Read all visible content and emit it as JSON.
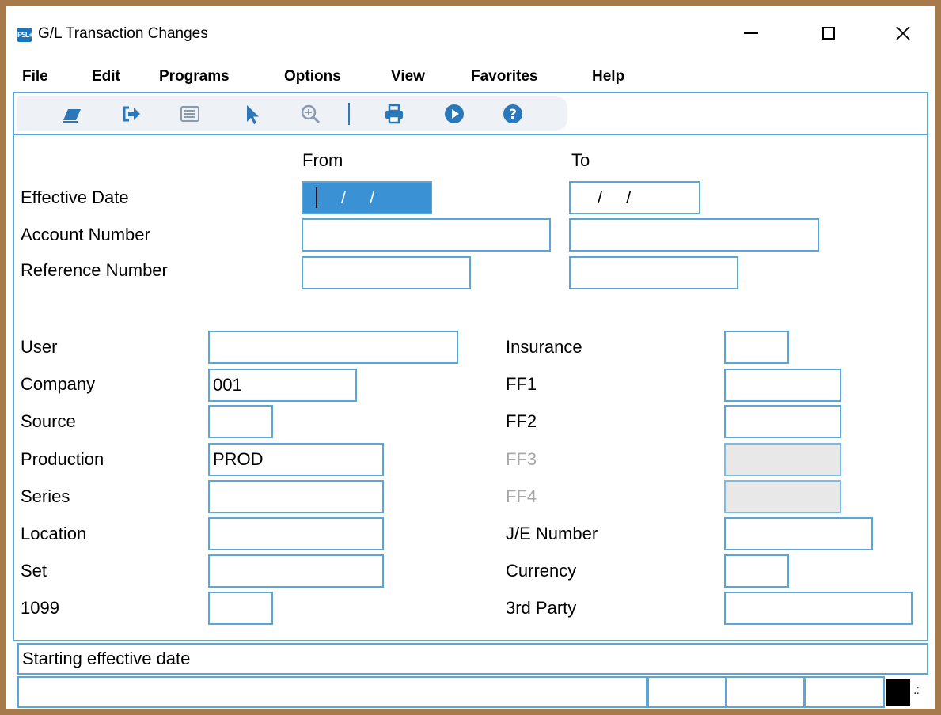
{
  "window": {
    "title": "G/L Transaction Changes",
    "app_icon_text": "PSL+"
  },
  "menu": [
    "File",
    "Edit",
    "Programs",
    "Options",
    "View",
    "Favorites",
    "Help"
  ],
  "toolbar": [
    {
      "icon": "eraser-icon"
    },
    {
      "icon": "exit-icon"
    },
    {
      "icon": "list-icon"
    },
    {
      "icon": "pointer-icon"
    },
    {
      "icon": "zoom-icon"
    },
    {
      "icon": "print-icon"
    },
    {
      "icon": "run-icon"
    },
    {
      "icon": "help-icon"
    }
  ],
  "range": {
    "from_header": "From",
    "to_header": "To",
    "effective_date_label": "Effective Date",
    "effective_date_from": "/ /",
    "effective_date_to": "/ /",
    "account_number_label": "Account Number",
    "reference_number_label": "Reference Number"
  },
  "left_fields": {
    "user": {
      "label": "User",
      "value": ""
    },
    "company": {
      "label": "Company",
      "value": "001"
    },
    "source": {
      "label": "Source",
      "value": ""
    },
    "production": {
      "label": "Production",
      "value": "PROD"
    },
    "series": {
      "label": "Series",
      "value": ""
    },
    "location": {
      "label": "Location",
      "value": ""
    },
    "set": {
      "label": "Set",
      "value": ""
    },
    "form1099": {
      "label": "1099",
      "value": ""
    }
  },
  "right_fields": {
    "insurance": {
      "label": "Insurance",
      "value": ""
    },
    "ff1": {
      "label": "FF1",
      "value": ""
    },
    "ff2": {
      "label": "FF2",
      "value": ""
    },
    "ff3": {
      "label": "FF3",
      "value": ""
    },
    "ff4": {
      "label": "FF4",
      "value": ""
    },
    "je_number": {
      "label": "J/E Number",
      "value": ""
    },
    "currency": {
      "label": "Currency",
      "value": ""
    },
    "third_party": {
      "label": "3rd Party",
      "value": ""
    }
  },
  "status": {
    "message": "Starting effective date"
  },
  "colors": {
    "accent": "#5aa7d7",
    "selected": "#3a92d5",
    "icon": "#2a78b9",
    "frame": "#a77a4b"
  }
}
